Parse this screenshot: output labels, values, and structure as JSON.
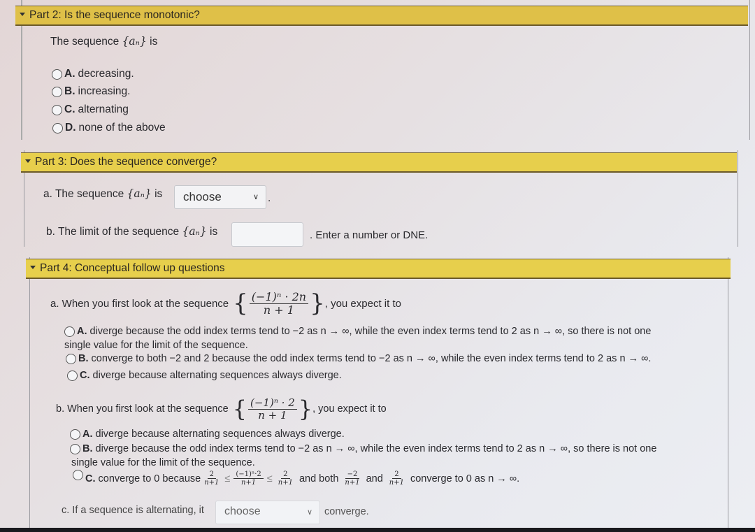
{
  "part2": {
    "header": "Part 2: Is the sequence monotonic?",
    "prompt_pre": "The sequence",
    "prompt_seq": "{aₙ}",
    "prompt_post": "is",
    "options": [
      {
        "letter": "A.",
        "text": "decreasing."
      },
      {
        "letter": "B.",
        "text": "increasing."
      },
      {
        "letter": "C.",
        "text": "alternating"
      },
      {
        "letter": "D.",
        "text": "none of the above"
      }
    ]
  },
  "part3": {
    "header": "Part 3: Does the sequence converge?",
    "a_pre": "a. The sequence",
    "a_seq": "{aₙ}",
    "a_post": "is",
    "a_select_value": "choose",
    "a_after": ".",
    "b_pre": "b. The limit of the sequence",
    "b_seq": "{aₙ}",
    "b_post": "is",
    "b_input_value": "",
    "b_hint": ". Enter a number or DNE."
  },
  "part4": {
    "header": "Part 4: Conceptual follow up questions",
    "qa": {
      "pre": "a. When you first look at the sequence",
      "numerator": "(−1)ⁿ · 2n",
      "denominator": "n + 1",
      "post": ", you expect it to",
      "options": [
        {
          "letter": "A.",
          "line1": "diverge because the odd index terms tend to −2 as n → ∞, while the even index terms tend to 2 as n → ∞, so there is not one",
          "line2": "single value for the limit of the sequence."
        },
        {
          "letter": "B.",
          "line1": "converge to both −2 and 2 because the odd index terms tend to −2 as n → ∞, while the even index terms tend to 2 as n → ∞."
        },
        {
          "letter": "C.",
          "line1": "diverge because alternating sequences always diverge."
        }
      ]
    },
    "qb": {
      "pre": "b. When you first look at the sequence",
      "numerator": "(−1)ⁿ · 2",
      "denominator": "n + 1",
      "post": ", you expect it to",
      "options": [
        {
          "letter": "A.",
          "line1": "diverge because alternating sequences always diverge."
        },
        {
          "letter": "B.",
          "line1": "diverge because the odd index terms tend to −2 as n → ∞, while the even index terms tend to 2 as n → ∞, so there is not one",
          "line2": "single value for the limit of the sequence."
        },
        {
          "letter": "C.",
          "pre": "converge to 0 because",
          "f1_num": "−2",
          "f1_den": "n+1",
          "leq": "≤",
          "f2_num": "(−1)ⁿ·2",
          "f2_den": "n+1",
          "f3_num": "2",
          "f3_den": "n+1",
          "mid": "and both",
          "f4_num": "−2",
          "f4_den": "n+1",
          "and": "and",
          "f5_num": "2",
          "f5_den": "n+1",
          "post": "converge to 0 as n → ∞."
        }
      ]
    },
    "qc": {
      "pre": "c. If a sequence is alternating, it",
      "select_value": "choose",
      "post": "converge."
    }
  }
}
